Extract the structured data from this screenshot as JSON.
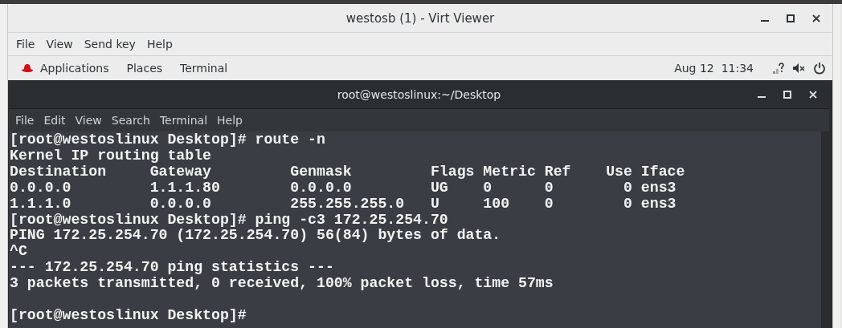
{
  "window": {
    "title": "westosb (1) - Virt Viewer"
  },
  "menu": [
    "File",
    "View",
    "Send key",
    "Help"
  ],
  "top_bar": {
    "items": [
      "Applications",
      "Places",
      "Terminal"
    ],
    "clock": "Aug 12  11:34"
  },
  "terminal": {
    "title": "root@westoslinux:~/Desktop",
    "menu": [
      "File",
      "Edit",
      "View",
      "Search",
      "Terminal",
      "Help"
    ],
    "lines": [
      "[root@westoslinux Desktop]# route -n",
      "Kernel IP routing table",
      "Destination     Gateway         Genmask         Flags Metric Ref    Use Iface",
      "0.0.0.0         1.1.1.80        0.0.0.0         UG    0      0        0 ens3",
      "1.1.1.0         0.0.0.0         255.255.255.0   U     100    0        0 ens3",
      "[root@westoslinux Desktop]# ping -c3 172.25.254.70",
      "PING 172.25.254.70 (172.25.254.70) 56(84) bytes of data.",
      "^C",
      "--- 172.25.254.70 ping statistics ---",
      "3 packets transmitted, 0 received, 100% packet loss, time 57ms"
    ],
    "prompt": "[root@westoslinux Desktop]#"
  }
}
